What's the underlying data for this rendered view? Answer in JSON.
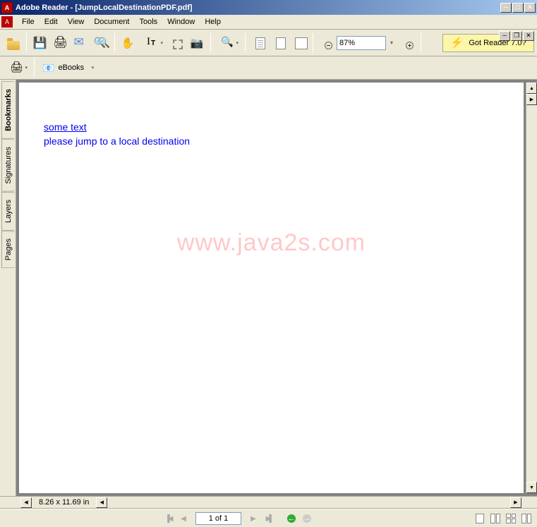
{
  "title": "Adobe Reader - [JumpLocalDestinationPDF.pdf]",
  "menus": [
    "File",
    "Edit",
    "View",
    "Document",
    "Tools",
    "Window",
    "Help"
  ],
  "toolbar": {
    "zoom_value": "87%",
    "got_reader": "Got Reader 7.0?"
  },
  "toolbar2": {
    "ebooks": "eBooks"
  },
  "sidebar": {
    "tabs": [
      "Bookmarks",
      "Signatures",
      "Layers",
      "Pages"
    ]
  },
  "page": {
    "link1": "some text",
    "link2": "please jump to a local destination",
    "watermark": "www.java2s.com"
  },
  "page_info": {
    "size": "8.26 x 11.69 in"
  },
  "status": {
    "page_num": "1 of 1"
  }
}
